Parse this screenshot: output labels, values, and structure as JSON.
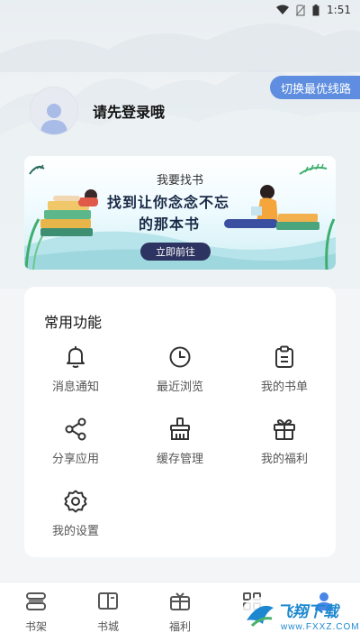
{
  "status_bar": {
    "time": "1:51"
  },
  "route_button": {
    "label": "切换最优线路"
  },
  "profile": {
    "login_prompt": "请先登录哦"
  },
  "banner": {
    "subtitle": "我要找书",
    "title_line1": "找到让你念念不忘",
    "title_line2": "的那本书",
    "button_label": "立即前往"
  },
  "functions": {
    "title": "常用功能",
    "items": [
      {
        "label": "消息通知",
        "icon": "bell-icon"
      },
      {
        "label": "最近浏览",
        "icon": "clock-icon"
      },
      {
        "label": "我的书单",
        "icon": "clipboard-icon"
      },
      {
        "label": "分享应用",
        "icon": "share-icon"
      },
      {
        "label": "缓存管理",
        "icon": "broom-icon"
      },
      {
        "label": "我的福利",
        "icon": "gift-icon"
      },
      {
        "label": "我的设置",
        "icon": "gear-icon"
      }
    ]
  },
  "bottom_nav": {
    "items": [
      {
        "label": "书架",
        "icon": "bookshelf-icon"
      },
      {
        "label": "书城",
        "icon": "open-book-icon"
      },
      {
        "label": "福利",
        "icon": "gift-icon"
      },
      {
        "label": "",
        "icon": "grid-icon"
      },
      {
        "label": "",
        "icon": "profile-icon"
      }
    ]
  },
  "watermark": {
    "text": "飞翔下载",
    "url": "www.FXXZ.COM"
  },
  "colors": {
    "accent_blue": "#5f8ee0",
    "banner_button": "#2d3461",
    "active_nav": "#4a86e8"
  }
}
